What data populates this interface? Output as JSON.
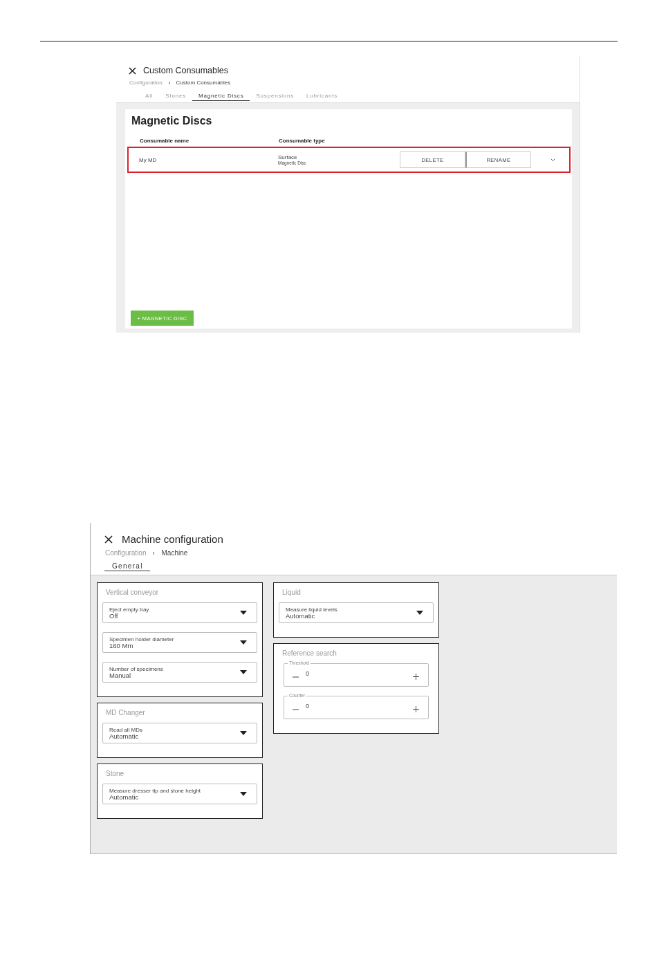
{
  "custom_consumables": {
    "title": "Custom Consumables",
    "breadcrumb": [
      "Configuration",
      "Custom Consumables"
    ],
    "tabs": [
      {
        "label": "All",
        "selected": false
      },
      {
        "label": "Stones",
        "selected": false
      },
      {
        "label": "Magnetic Discs",
        "selected": true
      },
      {
        "label": "Suspensions",
        "selected": false
      },
      {
        "label": "Lubricants",
        "selected": false
      }
    ],
    "heading": "Magnetic Discs",
    "columns": [
      "Consumable name",
      "Consumable type"
    ],
    "rows": [
      {
        "name": "My MD",
        "type": "Surface",
        "subtype": "Magnetic Disc",
        "highlighted": true,
        "actions": [
          "DELETE",
          "RENAME"
        ]
      }
    ],
    "add_button": "+ MAGNETIC DISC"
  },
  "machine_configuration": {
    "title": "Machine configuration",
    "breadcrumb": [
      "Configuration",
      "Machine"
    ],
    "tabs": [
      {
        "label": "General",
        "selected": true
      }
    ],
    "columns": [
      [
        {
          "title": "Vertical conveyor",
          "fields": [
            {
              "kind": "dropdown",
              "label": "Eject empty tray",
              "value": "Off"
            },
            {
              "kind": "dropdown",
              "label": "Specimen holder diameter",
              "value": "160 Mm"
            },
            {
              "kind": "dropdown",
              "label": "Number of specimens",
              "value": "Manual"
            }
          ]
        },
        {
          "title": "MD Changer",
          "fields": [
            {
              "kind": "dropdown",
              "label": "Read all MDs",
              "value": "Automatic"
            }
          ]
        },
        {
          "title": "Stone",
          "fields": [
            {
              "kind": "dropdown",
              "label": "Measure dresser tip and stone height",
              "value": "Automatic"
            }
          ]
        }
      ],
      [
        {
          "title": "Liquid",
          "fields": [
            {
              "kind": "dropdown",
              "label": "Measure liquid levels",
              "value": "Automatic"
            }
          ]
        },
        {
          "title": "Reference search",
          "fields": [
            {
              "kind": "stepper",
              "label": "Threshold",
              "value": "0"
            },
            {
              "kind": "stepper",
              "label": "Counter",
              "value": "0"
            }
          ]
        }
      ]
    ]
  }
}
